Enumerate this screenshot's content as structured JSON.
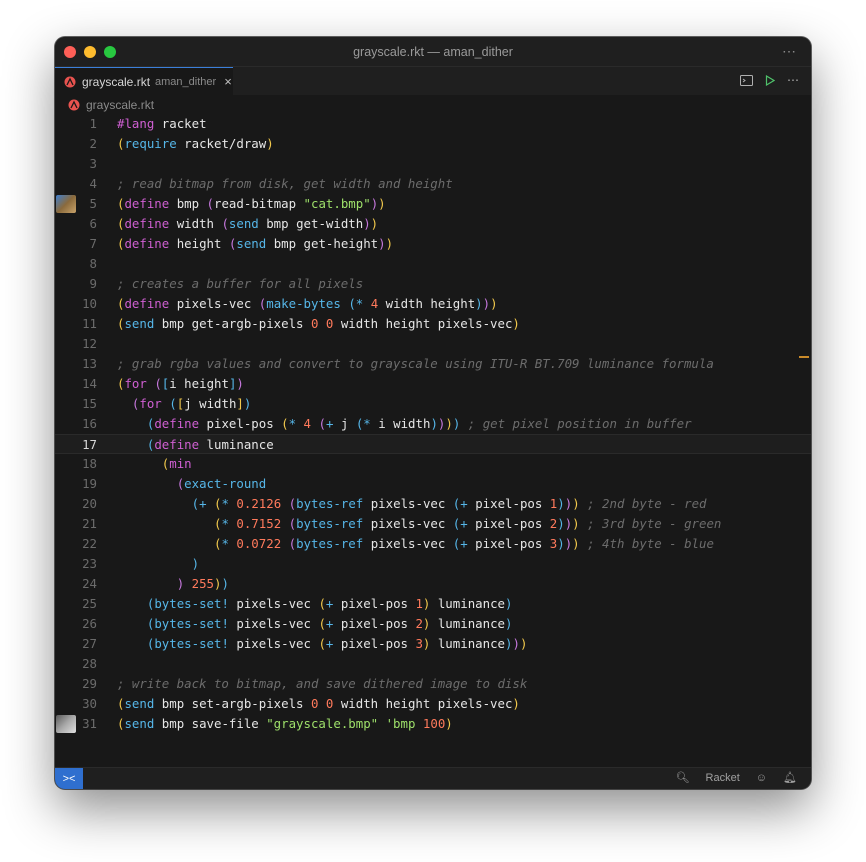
{
  "window": {
    "title": "grayscale.rkt — aman_dither"
  },
  "tab": {
    "name": "grayscale.rkt",
    "desc": "aman_dither",
    "close": "×"
  },
  "breadcrumb": {
    "file": "grayscale.rkt"
  },
  "status": {
    "language": "Racket"
  },
  "colors": {
    "accent": "#3b7fd9",
    "keyword": "#cf5fd2",
    "string": "#9ee06a",
    "number": "#ff7a5c",
    "comment": "#6c6c6c"
  },
  "editor": {
    "current_line": 17,
    "lines": [
      {
        "n": "1"
      },
      {
        "n": "2"
      },
      {
        "n": "3"
      },
      {
        "n": "4"
      },
      {
        "n": "5"
      },
      {
        "n": "6"
      },
      {
        "n": "7"
      },
      {
        "n": "8"
      },
      {
        "n": "9"
      },
      {
        "n": "10"
      },
      {
        "n": "11"
      },
      {
        "n": "12"
      },
      {
        "n": "13"
      },
      {
        "n": "14"
      },
      {
        "n": "15"
      },
      {
        "n": "16"
      },
      {
        "n": "17"
      },
      {
        "n": "18"
      },
      {
        "n": "19"
      },
      {
        "n": "20"
      },
      {
        "n": "21"
      },
      {
        "n": "22"
      },
      {
        "n": "23"
      },
      {
        "n": "24"
      },
      {
        "n": "25"
      },
      {
        "n": "26"
      },
      {
        "n": "27"
      },
      {
        "n": "28"
      },
      {
        "n": "29"
      },
      {
        "n": "30"
      },
      {
        "n": "31"
      }
    ],
    "code": {
      "l1": [
        [
          "kw",
          "#lang"
        ],
        [
          "sym",
          " racket"
        ]
      ],
      "l2": [
        [
          "b1",
          "("
        ],
        [
          "op",
          "require"
        ],
        [
          "sym",
          " racket/draw"
        ],
        [
          "b1",
          ")"
        ]
      ],
      "l4": [
        [
          "com",
          "; read bitmap from disk, get width and height"
        ]
      ],
      "l5": [
        [
          "b1",
          "("
        ],
        [
          "kw",
          "define"
        ],
        [
          "sym",
          " bmp "
        ],
        [
          "b2",
          "("
        ],
        [
          "sym",
          "read-bitmap "
        ],
        [
          "str",
          "\"cat.bmp\""
        ],
        [
          "b2",
          ")"
        ],
        [
          "b1",
          ")"
        ]
      ],
      "l6": [
        [
          "b1",
          "("
        ],
        [
          "kw",
          "define"
        ],
        [
          "sym",
          " width "
        ],
        [
          "b2",
          "("
        ],
        [
          "send",
          "send"
        ],
        [
          "sym",
          " bmp get-width"
        ],
        [
          "b2",
          ")"
        ],
        [
          "b1",
          ")"
        ]
      ],
      "l7": [
        [
          "b1",
          "("
        ],
        [
          "kw",
          "define"
        ],
        [
          "sym",
          " height "
        ],
        [
          "b2",
          "("
        ],
        [
          "send",
          "send"
        ],
        [
          "sym",
          " bmp get-height"
        ],
        [
          "b2",
          ")"
        ],
        [
          "b1",
          ")"
        ]
      ],
      "l9": [
        [
          "com",
          "; creates a buffer for all pixels"
        ]
      ],
      "l10": [
        [
          "b1",
          "("
        ],
        [
          "kw",
          "define"
        ],
        [
          "sym",
          " pixels-vec "
        ],
        [
          "b2",
          "("
        ],
        [
          "send",
          "make-bytes"
        ],
        [
          "sym",
          " "
        ],
        [
          "b3",
          "("
        ],
        [
          "op",
          "*"
        ],
        [
          "sym",
          " "
        ],
        [
          "num",
          "4"
        ],
        [
          "sym",
          " width height"
        ],
        [
          "b3",
          ")"
        ],
        [
          "b2",
          ")"
        ],
        [
          "b1",
          ")"
        ]
      ],
      "l11": [
        [
          "b1",
          "("
        ],
        [
          "send",
          "send"
        ],
        [
          "sym",
          " bmp get-argb-pixels "
        ],
        [
          "num",
          "0"
        ],
        [
          "sym",
          " "
        ],
        [
          "num",
          "0"
        ],
        [
          "sym",
          " width height pixels-vec"
        ],
        [
          "b1",
          ")"
        ]
      ],
      "l13": [
        [
          "com",
          "; grab rgba values and convert to grayscale using ITU-R BT.709 luminance formula"
        ]
      ],
      "l14": [
        [
          "b1",
          "("
        ],
        [
          "kw",
          "for"
        ],
        [
          "sym",
          " "
        ],
        [
          "b2",
          "("
        ],
        [
          "b3",
          "["
        ],
        [
          "sym",
          "i height"
        ],
        [
          "b3",
          "]"
        ],
        [
          "b2",
          ")"
        ]
      ],
      "l15": [
        [
          "sym",
          "  "
        ],
        [
          "b2",
          "("
        ],
        [
          "kw",
          "for"
        ],
        [
          "sym",
          " "
        ],
        [
          "b3",
          "("
        ],
        [
          "b1",
          "["
        ],
        [
          "sym",
          "j width"
        ],
        [
          "b1",
          "]"
        ],
        [
          "b3",
          ")"
        ]
      ],
      "l16": [
        [
          "sym",
          "    "
        ],
        [
          "b3",
          "("
        ],
        [
          "kw",
          "define"
        ],
        [
          "sym",
          " pixel-pos "
        ],
        [
          "b1",
          "("
        ],
        [
          "op",
          "*"
        ],
        [
          "sym",
          " "
        ],
        [
          "num",
          "4"
        ],
        [
          "sym",
          " "
        ],
        [
          "b2",
          "("
        ],
        [
          "op",
          "+"
        ],
        [
          "sym",
          " j "
        ],
        [
          "b3",
          "("
        ],
        [
          "op",
          "*"
        ],
        [
          "sym",
          " i width"
        ],
        [
          "b3",
          ")"
        ],
        [
          "b2",
          ")"
        ],
        [
          "b1",
          ")"
        ],
        [
          "b3",
          ")"
        ],
        [
          "com",
          " ; get pixel position in buffer"
        ]
      ],
      "l17": [
        [
          "sym",
          "    "
        ],
        [
          "b3",
          "("
        ],
        [
          "kw",
          "define"
        ],
        [
          "sym",
          " luminance"
        ]
      ],
      "l18": [
        [
          "sym",
          "      "
        ],
        [
          "b1",
          "("
        ],
        [
          "kw",
          "min"
        ]
      ],
      "l19": [
        [
          "sym",
          "        "
        ],
        [
          "b2",
          "("
        ],
        [
          "send",
          "exact-round"
        ]
      ],
      "l20": [
        [
          "sym",
          "          "
        ],
        [
          "b3",
          "("
        ],
        [
          "op",
          "+"
        ],
        [
          "sym",
          " "
        ],
        [
          "b1",
          "("
        ],
        [
          "op",
          "*"
        ],
        [
          "sym",
          " "
        ],
        [
          "num",
          "0.2126"
        ],
        [
          "sym",
          " "
        ],
        [
          "b2",
          "("
        ],
        [
          "send",
          "bytes-ref"
        ],
        [
          "sym",
          " pixels-vec "
        ],
        [
          "b3",
          "("
        ],
        [
          "op",
          "+"
        ],
        [
          "sym",
          " pixel-pos "
        ],
        [
          "num",
          "1"
        ],
        [
          "b3",
          ")"
        ],
        [
          "b2",
          ")"
        ],
        [
          "b1",
          ")"
        ],
        [
          "com",
          " ; 2nd byte - red"
        ]
      ],
      "l21": [
        [
          "sym",
          "             "
        ],
        [
          "b1",
          "("
        ],
        [
          "op",
          "*"
        ],
        [
          "sym",
          " "
        ],
        [
          "num",
          "0.7152"
        ],
        [
          "sym",
          " "
        ],
        [
          "b2",
          "("
        ],
        [
          "send",
          "bytes-ref"
        ],
        [
          "sym",
          " pixels-vec "
        ],
        [
          "b3",
          "("
        ],
        [
          "op",
          "+"
        ],
        [
          "sym",
          " pixel-pos "
        ],
        [
          "num",
          "2"
        ],
        [
          "b3",
          ")"
        ],
        [
          "b2",
          ")"
        ],
        [
          "b1",
          ")"
        ],
        [
          "com",
          " ; 3rd byte - green"
        ]
      ],
      "l22": [
        [
          "sym",
          "             "
        ],
        [
          "b1",
          "("
        ],
        [
          "op",
          "*"
        ],
        [
          "sym",
          " "
        ],
        [
          "num",
          "0.0722"
        ],
        [
          "sym",
          " "
        ],
        [
          "b2",
          "("
        ],
        [
          "send",
          "bytes-ref"
        ],
        [
          "sym",
          " pixels-vec "
        ],
        [
          "b3",
          "("
        ],
        [
          "op",
          "+"
        ],
        [
          "sym",
          " pixel-pos "
        ],
        [
          "num",
          "3"
        ],
        [
          "b3",
          ")"
        ],
        [
          "b2",
          ")"
        ],
        [
          "b1",
          ")"
        ],
        [
          "com",
          " ; 4th byte - blue"
        ]
      ],
      "l23": [
        [
          "sym",
          "          "
        ],
        [
          "b3",
          ")"
        ]
      ],
      "l24": [
        [
          "sym",
          "        "
        ],
        [
          "b2",
          ")"
        ],
        [
          "sym",
          " "
        ],
        [
          "num",
          "255"
        ],
        [
          "b1",
          ")"
        ],
        [
          "b3",
          ")"
        ]
      ],
      "l25": [
        [
          "sym",
          "    "
        ],
        [
          "b3",
          "("
        ],
        [
          "send",
          "bytes-set!"
        ],
        [
          "sym",
          " pixels-vec "
        ],
        [
          "b1",
          "("
        ],
        [
          "op",
          "+"
        ],
        [
          "sym",
          " pixel-pos "
        ],
        [
          "num",
          "1"
        ],
        [
          "b1",
          ")"
        ],
        [
          "sym",
          " luminance"
        ],
        [
          "b3",
          ")"
        ]
      ],
      "l26": [
        [
          "sym",
          "    "
        ],
        [
          "b3",
          "("
        ],
        [
          "send",
          "bytes-set!"
        ],
        [
          "sym",
          " pixels-vec "
        ],
        [
          "b1",
          "("
        ],
        [
          "op",
          "+"
        ],
        [
          "sym",
          " pixel-pos "
        ],
        [
          "num",
          "2"
        ],
        [
          "b1",
          ")"
        ],
        [
          "sym",
          " luminance"
        ],
        [
          "b3",
          ")"
        ]
      ],
      "l27": [
        [
          "sym",
          "    "
        ],
        [
          "b3",
          "("
        ],
        [
          "send",
          "bytes-set!"
        ],
        [
          "sym",
          " pixels-vec "
        ],
        [
          "b1",
          "("
        ],
        [
          "op",
          "+"
        ],
        [
          "sym",
          " pixel-pos "
        ],
        [
          "num",
          "3"
        ],
        [
          "b1",
          ")"
        ],
        [
          "sym",
          " luminance"
        ],
        [
          "b3",
          ")"
        ],
        [
          "b2",
          ")"
        ],
        [
          "b1",
          ")"
        ]
      ],
      "l29": [
        [
          "com",
          "; write back to bitmap, and save dithered image to disk"
        ]
      ],
      "l30": [
        [
          "b1",
          "("
        ],
        [
          "send",
          "send"
        ],
        [
          "sym",
          " bmp set-argb-pixels "
        ],
        [
          "num",
          "0"
        ],
        [
          "sym",
          " "
        ],
        [
          "num",
          "0"
        ],
        [
          "sym",
          " width height pixels-vec"
        ],
        [
          "b1",
          ")"
        ]
      ],
      "l31": [
        [
          "b1",
          "("
        ],
        [
          "send",
          "send"
        ],
        [
          "sym",
          " bmp save-file "
        ],
        [
          "str",
          "\"grayscale.bmp\""
        ],
        [
          "sym",
          " "
        ],
        [
          "str",
          "'bmp"
        ],
        [
          "sym",
          " "
        ],
        [
          "num",
          "100"
        ],
        [
          "b1",
          ")"
        ]
      ]
    }
  }
}
